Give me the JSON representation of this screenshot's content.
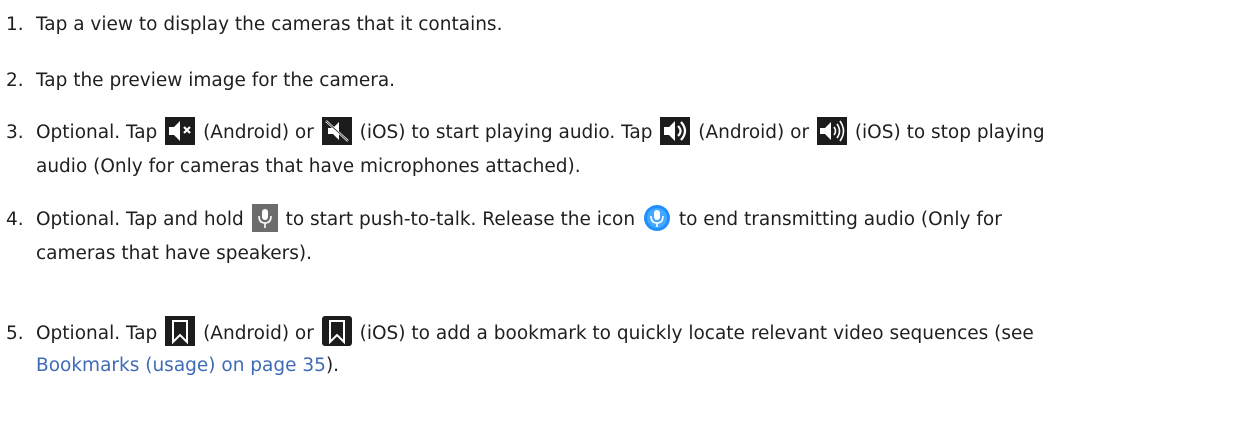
{
  "steps": [
    {
      "number": "1.",
      "text": "Tap a view to display the cameras that it contains."
    },
    {
      "number": "2.",
      "text": "Tap the preview image for the camera."
    },
    {
      "number": "3.",
      "p1": "Optional. Tap",
      "p2": "(Android) or",
      "p3": "(iOS) to start playing audio. Tap",
      "p4": "(Android) or",
      "p5": "(iOS) to stop playing",
      "p6": "audio (Only for cameras that have microphones attached).",
      "icons": [
        "android-mute-icon",
        "ios-mute-icon",
        "android-speaker-icon",
        "ios-speaker-icon"
      ]
    },
    {
      "number": "4.",
      "p1": "Optional. Tap and hold",
      "p2": "to start push-to-talk. Release the icon",
      "p3": "to end transmitting audio (Only for",
      "p4": "cameras that have speakers).",
      "icons": [
        "microphone-icon",
        "microphone-active-icon"
      ]
    },
    {
      "number": "5.",
      "p1": "Optional. Tap",
      "p2": "(Android) or",
      "p3": "(iOS) to add a bookmark to quickly locate relevant video sequences (see",
      "link": "Bookmarks (usage) on page 35",
      "p4": ").",
      "icons": [
        "android-bookmark-icon",
        "ios-bookmark-icon"
      ]
    }
  ],
  "colors": {
    "text": "#1f1f1f",
    "link": "#3f6bb5",
    "icon_dark": "#1c1c1c",
    "mic_gray": "#6c6c6c",
    "mic_blue": "#1f8fff"
  }
}
